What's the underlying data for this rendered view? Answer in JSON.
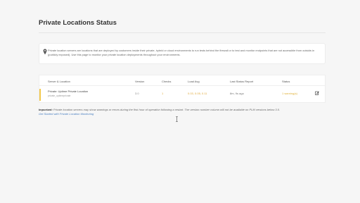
{
  "page": {
    "title": "Private Locations Status"
  },
  "info": {
    "icon": "map-pin-icon",
    "text": "Private location servers are locations that are deployed by customers inside their private, hybrid or cloud environments to run tests behind the firewall or to test and monitor endpoints that are not accessible from outside-in (publicly exposed). Use this page to monitor your private location deployments throughout your environments."
  },
  "table": {
    "headers": [
      "Server & Location",
      "Version",
      "Checks",
      "Load Avg",
      "Last Status Report",
      "Status"
    ],
    "rows": [
      {
        "name": "Private: Uptime Private Location",
        "subname": "private_uptimeprivate",
        "version": "3.0",
        "checks": "1",
        "load_avg": "0.03, 0.05, 0.11",
        "last_report": "8m, 9s ago",
        "status": "1 warning(s)",
        "action_icon": "edit-icon"
      }
    ]
  },
  "notes": {
    "important_label": "Important:",
    "important_text": "Private location servers may show warnings or errors during the first hour of operation following a restart. The version number column will not be available on PLM versions below 3.0.",
    "link_text": "Get Started with Private Location Monitoring"
  },
  "colors": {
    "accent_warning": "#f2c84b",
    "link": "#4a7fc1"
  }
}
